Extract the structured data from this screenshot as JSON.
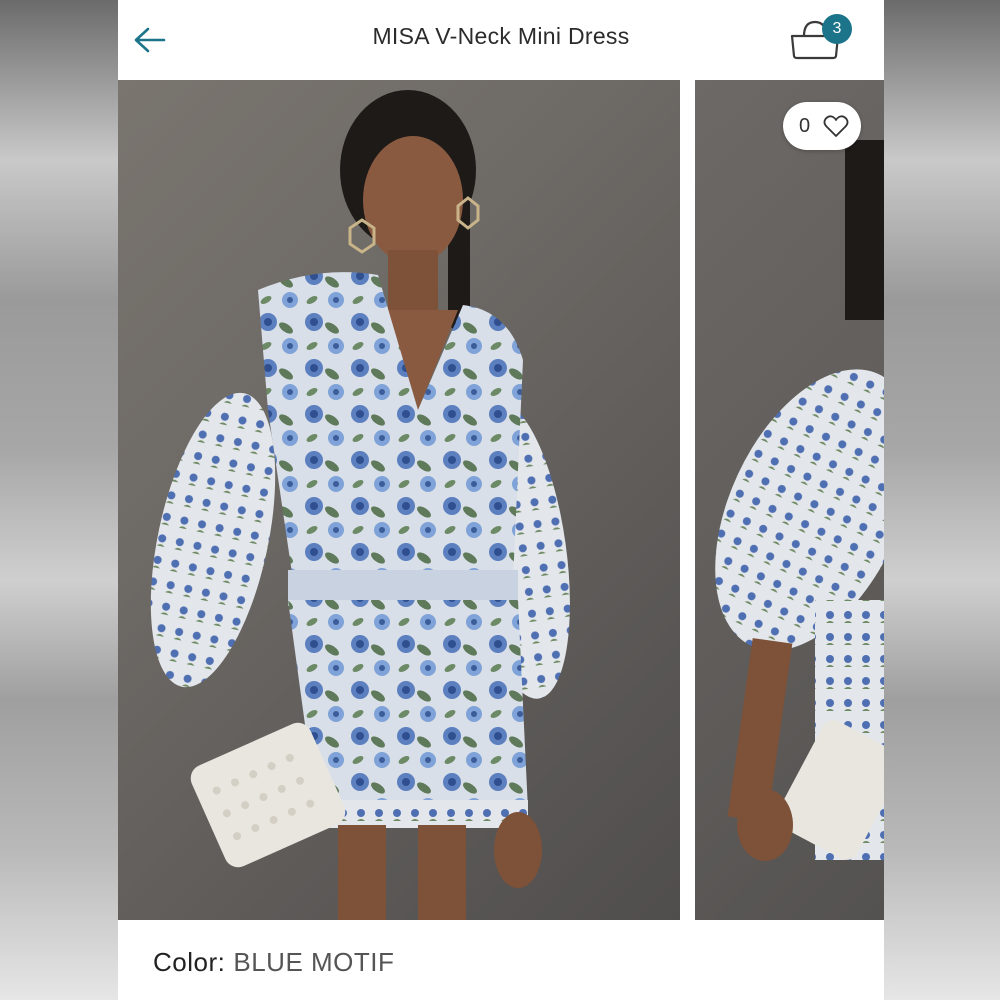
{
  "header": {
    "title": "MISA V-Neck Mini Dress",
    "bag_count": "3"
  },
  "gallery": {
    "favorites_count": "0",
    "photos": [
      "model-front-photo",
      "model-side-photo"
    ]
  },
  "product": {
    "color_label": "Color:",
    "color_value": "BLUE MOTIF"
  },
  "theme": {
    "accent": "#1b7489",
    "text": "#2b2b2b"
  }
}
